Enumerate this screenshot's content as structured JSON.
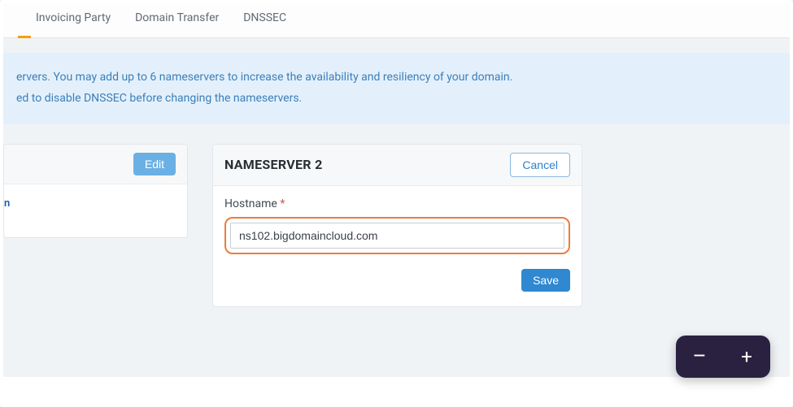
{
  "tabs": {
    "invoicing": "Invoicing Party",
    "transfer": "Domain Transfer",
    "dnssec": "DNSSEC"
  },
  "banner": {
    "line1": "ervers. You may add up to 6 nameservers to increase the availability and resiliency of your domain.",
    "line2": "ed to disable DNSSEC before changing the nameservers."
  },
  "left_panel": {
    "edit_label": "Edit",
    "truncated": "n"
  },
  "right_panel": {
    "title": "NAMESERVER 2",
    "cancel_label": "Cancel",
    "hostname_label": "Hostname",
    "required_mark": "*",
    "hostname_value": "ns102.bigdomaincloud.com",
    "save_label": "Save"
  },
  "zoom": {
    "minus": "–",
    "plus": "+"
  }
}
